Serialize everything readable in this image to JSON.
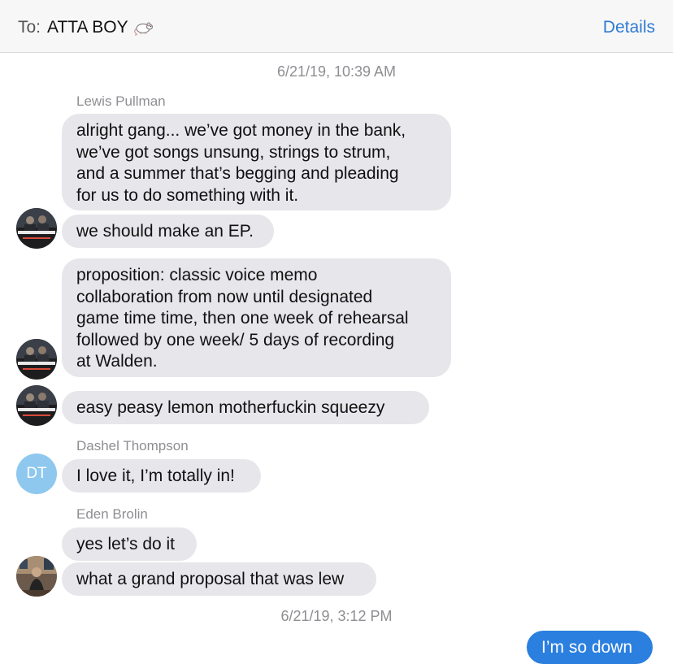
{
  "header": {
    "to_label": "To:",
    "recipient": "ATTA BOY",
    "recipient_icon": "rat-icon",
    "details_label": "Details"
  },
  "timestamps": [
    "6/21/19, 10:39 AM",
    "6/21/19, 3:12 PM"
  ],
  "senders": {
    "lewis": "Lewis Pullman",
    "dashel": "Dashel Thompson",
    "eden": "Eden Brolin"
  },
  "dashel_initials": "DT",
  "messages": [
    "alright gang... we’ve got money in the bank,\nwe’ve got songs unsung, strings to strum,\nand a summer that’s begging and pleading\nfor us to do something with it.",
    "we should make an EP.",
    "proposition: classic voice memo\ncollaboration from now until designated\ngame time time, then one week of rehearsal\nfollowed by one week/ 5 days of recording\nat Walden.",
    "easy peasy lemon motherfuckin squeezy",
    "I love it, I’m totally in!",
    "yes let’s do it",
    "what a grand proposal that was lew",
    "I’m so down"
  ],
  "colors": {
    "incoming_bubble": "#e6e6eb",
    "outgoing_bubble": "#2a7fdf",
    "link_blue": "#2f7bd1",
    "meta_gray": "#8e8e93"
  }
}
